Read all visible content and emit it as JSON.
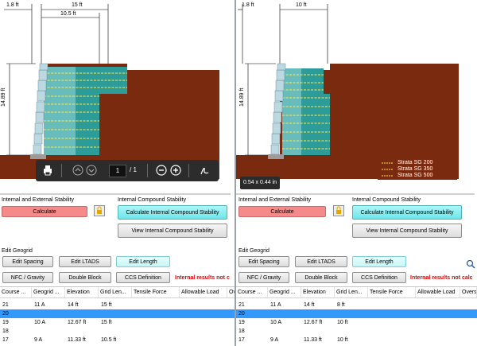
{
  "left": {
    "dims": {
      "top_dim": "1.8 ft",
      "mid_dim": "15 ft",
      "inner_dim": "10.5 ft",
      "height_dim": "14.89 ft"
    },
    "pdf_toolbar": {
      "page_current": "1",
      "page_total": "/ 1"
    },
    "stability": {
      "internal_external_label": "Internal and External Stability",
      "calculate_label": "Calculate",
      "compound_label": "Internal Compound Stability",
      "calc_compound_label": "Calculate Internal Compound Stability",
      "view_compound_label": "View Internal Compound Stability"
    },
    "edit_geogrid": {
      "title": "Edit Geogrid",
      "edit_spacing": "Edit Spacing",
      "edit_ltads": "Edit LTADS",
      "edit_length": "Edit Length",
      "nfc_gravity": "NFC / Gravity",
      "double_block": "Double Block",
      "ccs_definition": "CCS Definition",
      "warning": "Internal results not c"
    },
    "table": {
      "headers": [
        "Course ...",
        "Geogrid ...",
        "Elevation",
        "Grid Len...",
        "Tensile Force",
        "Allowable Load",
        "Ov"
      ],
      "rows": [
        [
          "21",
          "11 A",
          "14 ft",
          "15 ft",
          "",
          "",
          ""
        ],
        [
          "20",
          "",
          "",
          "",
          "",
          "",
          ""
        ],
        [
          "19",
          "10 A",
          "12.67 ft",
          "15 ft",
          "",
          "",
          ""
        ],
        [
          "18",
          "",
          "",
          "",
          "",
          "",
          ""
        ],
        [
          "17",
          "9 A",
          "11.33 ft",
          "10.5 ft",
          "",
          "",
          ""
        ]
      ]
    }
  },
  "right": {
    "dims": {
      "top_dim": "1.8 ft",
      "mid_dim": "10 ft",
      "height_dim": "14.89 ft"
    },
    "legend": [
      "Strata SG 200",
      "Strata SG 350",
      "Strata SG 500"
    ],
    "tooltip": "0.54 x 0.44 in",
    "stability": {
      "internal_external_label": "Internal and External Stability",
      "calculate_label": "Calculate",
      "compound_label": "Internal Compound Stability",
      "calc_compound_label": "Calculate Internal Compound Stability",
      "view_compound_label": "View Internal Compound Stability"
    },
    "edit_geogrid": {
      "title": "Edit Geogrid",
      "edit_spacing": "Edit Spacing",
      "edit_ltads": "Edit LTADS",
      "edit_length": "Edit Length",
      "nfc_gravity": "NFC / Gravity",
      "double_block": "Double Block",
      "ccs_definition": "CCS Definition",
      "warning": "Internal results not calc"
    },
    "table": {
      "headers": [
        "Course ...",
        "Geogrid ...",
        "Elevation",
        "Grid Len...",
        "Tensile Force",
        "Allowable Load",
        "Overs"
      ],
      "rows": [
        [
          "21",
          "11 A",
          "14 ft",
          "8 ft",
          "",
          "",
          ""
        ],
        [
          "20",
          "",
          "",
          "",
          "",
          "",
          ""
        ],
        [
          "19",
          "10 A",
          "12.67 ft",
          "10 ft",
          "",
          "",
          ""
        ],
        [
          "18",
          "",
          "",
          "",
          "",
          "",
          ""
        ],
        [
          "17",
          "9 A",
          "11.33 ft",
          "10 ft",
          "",
          "",
          ""
        ]
      ]
    }
  },
  "colors": {
    "soil": "#7a2a0e",
    "reinforced_fill": "#2d9c99",
    "grid_line": "#ffe84a",
    "block": "#bcd8e0",
    "selected_row": "#3399ff",
    "warning": "#e00000"
  },
  "selected_row_index": 1
}
